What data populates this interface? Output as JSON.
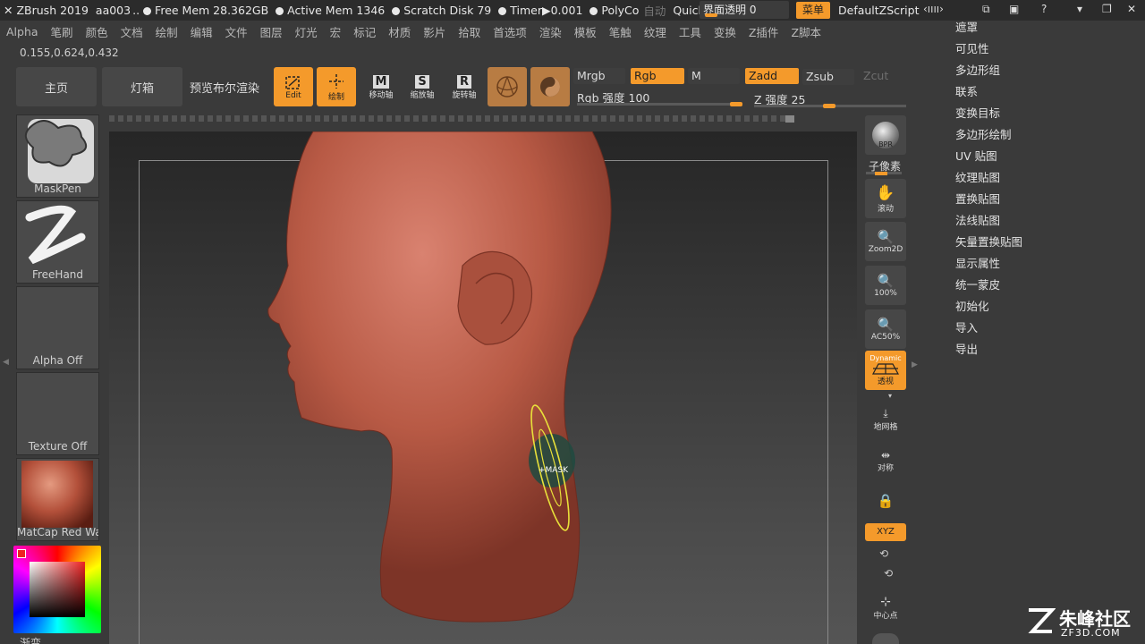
{
  "titlebar": {
    "app": "ZBrush 2019",
    "doc": "aa003",
    "ellipsis": "..",
    "free_mem": "Free Mem 28.362GB",
    "active_mem": "Active Mem 1346",
    "scratch": "Scratch Disk 79",
    "timer": "Timer▶0.001",
    "polycount": "PolyCo",
    "auto": "自动",
    "quicksave": "QuickSave",
    "transparency": "界面透明 0",
    "menu_btn": "菜单",
    "script": "DefaultZScript"
  },
  "menubar": [
    "Alpha",
    "笔刷",
    "颜色",
    "文档",
    "绘制",
    "编辑",
    "文件",
    "图层",
    "灯光",
    "宏",
    "标记",
    "材质",
    "影片",
    "拾取",
    "首选项",
    "渲染",
    "模板",
    "笔触",
    "纹理",
    "工具",
    "变换",
    "Z插件",
    "Z脚本"
  ],
  "coords": "0.155,0.624,0.432",
  "toolbar": {
    "home": "主页",
    "lightbox": "灯箱",
    "bpr_preview": "预览布尔渲染",
    "edit": "Edit",
    "draw": "绘制",
    "move": "移动轴",
    "scale": "缩放轴",
    "rotate": "旋转轴",
    "mrgb": "Mrgb",
    "rgb": "Rgb",
    "m": "M",
    "zadd": "Zadd",
    "zsub": "Zsub",
    "zcut": "Zcut",
    "rgb_intensity": "Rgb 强度 100",
    "z_intensity": "Z 强度 25",
    "rgb_intensity_value": 100,
    "z_intensity_value": 25
  },
  "left_tiles": {
    "brush": "MaskPen",
    "stroke": "FreeHand",
    "alpha": "Alpha Off",
    "texture": "Texture Off",
    "material": "MatCap Red Wax",
    "gradient": "渐变"
  },
  "right_toolbar": {
    "bpr": "BPR",
    "subpixel": "子像素",
    "scroll": "滚动",
    "zoom2d": "Zoom2D",
    "actual": "100%",
    "ac50": "AC50%",
    "dynamic": "Dynamic",
    "persp": "透视",
    "floor": "地网格",
    "sym": "对称",
    "xyz": "XYZ",
    "center": "中心点"
  },
  "right_menu": [
    "遮罩",
    "可见性",
    "多边形组",
    "联系",
    "变换目标",
    "多边形绘制",
    "UV 贴图",
    "纹理贴图",
    "置换贴图",
    "法线贴图",
    "矢量置换贴图",
    "显示属性",
    "统一蒙皮",
    "初始化",
    "导入",
    "导出"
  ],
  "cursor_label": "+MASK",
  "watermark": {
    "cn": "朱峰社区",
    "url": "ZF3D.COM"
  },
  "colors": {
    "accent": "#f49a2b",
    "skin": "#b85a45",
    "mask": "#1f4a3f"
  }
}
